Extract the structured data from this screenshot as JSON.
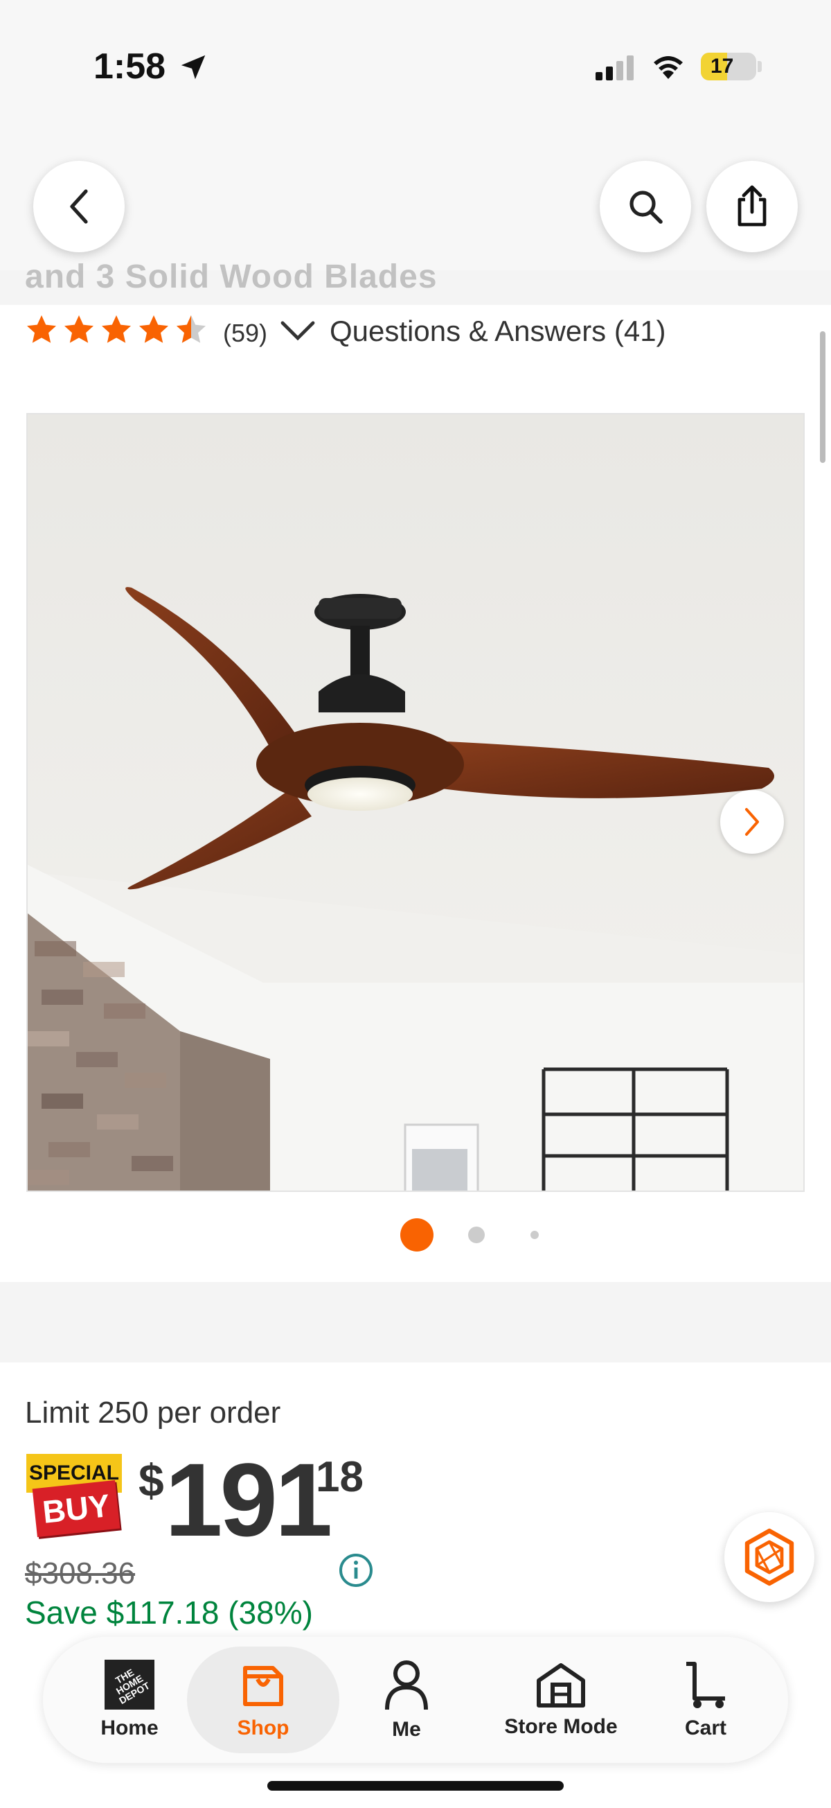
{
  "status_bar": {
    "time": "1:58",
    "battery_level": "17",
    "icons": [
      "location-arrow-icon",
      "cellular-signal-icon",
      "wifi-icon",
      "battery-icon"
    ]
  },
  "header": {
    "back_icon": "chevron-left-icon",
    "search_icon": "search-icon",
    "share_icon": "share-icon",
    "title_fragment": "and 3 Solid Wood Blades"
  },
  "ratings": {
    "stars": 4.5,
    "count": "(59)",
    "qa_label": "Questions & Answers (41)"
  },
  "gallery": {
    "image_description_icon": "ceiling-fan-image",
    "next_icon": "chevron-right-icon",
    "dot_count": 3,
    "active_dot": 1
  },
  "pricing": {
    "limit": "Limit 250 per order",
    "badge_top": "SPECIAL",
    "badge_bottom": "BUY",
    "currency": "$",
    "price_dollars": "191",
    "price_cents": "18",
    "was_price": "$308.36",
    "save_text": "Save $117.18 (38%)",
    "info_icon": "info-icon"
  },
  "chat": {
    "icon": "chat-hexagon-icon"
  },
  "bottom_nav": {
    "items": [
      {
        "label": "Home",
        "icon": "home-depot-logo-icon"
      },
      {
        "label": "Shop",
        "icon": "shop-bag-icon",
        "active": true
      },
      {
        "label": "Me",
        "icon": "person-icon"
      },
      {
        "label": "Store Mode",
        "icon": "store-icon"
      },
      {
        "label": "Cart",
        "icon": "cart-icon"
      }
    ],
    "logo_text": "THE HOME DEPOT"
  },
  "colors": {
    "accent": "#f96302",
    "save_green": "#00843d",
    "special_yellow": "#f5c518",
    "special_red": "#d82027"
  }
}
